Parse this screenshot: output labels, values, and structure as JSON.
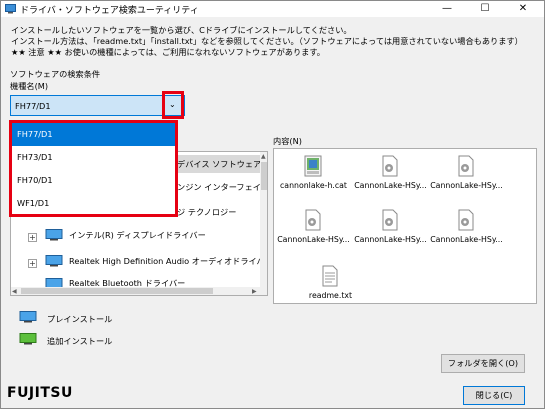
{
  "window": {
    "title": "ドライバ・ソフトウェア検索ユーティリティ",
    "minimize": "—",
    "maximize": "☐",
    "close": "✕"
  },
  "description": {
    "line1": "インストールしたいソフトウェアを一覧から選び、Cドライブにインストールしてください。",
    "line2": "インストール方法は、「readme.txt」「install.txt」などを参照してください。（ソフトウェアによっては用意されていない場合もあります）",
    "line3": "★★ 注意 ★★ お使いの機種によっては、ご利用になれないソフトウェアがあります。"
  },
  "search": {
    "label": "ソフトウェアの検索条件",
    "model_label": "機種名(M)",
    "selected": "FH77/D1",
    "options": [
      "FH77/D1",
      "FH73/D1",
      "FH70/D1",
      "WF1/D1"
    ]
  },
  "tree": {
    "items": [
      {
        "label": "デバイス ソフトウェア"
      },
      {
        "label": "ンジン インターフェイ"
      },
      {
        "label": "ジ テクノロジー"
      },
      {
        "label": "インテル(R) ディスプレイドライバー"
      },
      {
        "label": "Realtek High Definition Audio オーディオドライバ"
      },
      {
        "label": "Realtek Bluetooth ドライバー"
      }
    ]
  },
  "content": {
    "label": "内容(N)",
    "files": [
      {
        "name": "cannonlake-h.cat",
        "icon": "catalog-file-icon"
      },
      {
        "name": "CannonLake-HSy...",
        "icon": "settings-file-icon"
      },
      {
        "name": "CannonLake-HSy...",
        "icon": "settings-file-icon"
      },
      {
        "name": "CannonLake-HSy...",
        "icon": "settings-file-icon"
      },
      {
        "name": "CannonLake-HSy...",
        "icon": "settings-file-icon"
      },
      {
        "name": "CannonLake-HSy...",
        "icon": "settings-file-icon"
      },
      {
        "name": "readme.txt",
        "icon": "text-file-icon"
      }
    ]
  },
  "legend": {
    "preinstall": "プレインストール",
    "additional": "追加インストール"
  },
  "buttons": {
    "open_folder": "フォルダを開く(O)",
    "close": "閉じる(C)"
  },
  "brand": {
    "logo": "FUJITSU"
  },
  "colors": {
    "selection": "#0078d7",
    "highlight": "#e60012",
    "brand_red": "#e60012"
  }
}
